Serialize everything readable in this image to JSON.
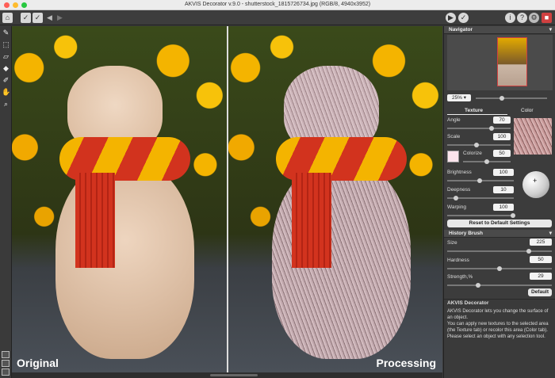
{
  "window": {
    "title": "AKVIS Decorator v.9.0 - shutterstock_1815726734.jpg (RGB/8, 4940x3952)"
  },
  "toolbar": {
    "left_icons": [
      "home-icon",
      "check-icon",
      "check-icon",
      "undo-icon",
      "redo-icon"
    ],
    "right_icons": [
      "play-icon",
      "apply-icon",
      "info-icon",
      "help-icon",
      "settings-icon",
      "gift-icon"
    ]
  },
  "tools": [
    "brush-icon",
    "selection-icon",
    "eraser-icon",
    "bucket-icon",
    "history-brush-icon",
    "hand-icon",
    "zoom-icon"
  ],
  "canvas": {
    "before_label": "Original",
    "after_label": "Processing"
  },
  "navigator": {
    "title": "Navigator",
    "zoom": "25%"
  },
  "tabs": {
    "texture": "Texture",
    "color": "Color"
  },
  "params": {
    "angle": {
      "label": "Angle",
      "value": "70"
    },
    "scale": {
      "label": "Scale",
      "value": "100"
    },
    "colorize": {
      "label": "Colorize",
      "value": "50"
    },
    "brightness": {
      "label": "Brightness",
      "value": "100"
    },
    "deepness": {
      "label": "Deepness",
      "value": "10"
    },
    "warping": {
      "label": "Warping",
      "value": "100"
    }
  },
  "reset_button": "Reset to Default Settings",
  "history_brush": {
    "title": "History Brush",
    "size": {
      "label": "Size",
      "value": "225"
    },
    "hardness": {
      "label": "Hardness",
      "value": "50"
    },
    "strength": {
      "label": "Strength,%",
      "value": "29"
    },
    "default_button": "Default"
  },
  "info_panel": {
    "title": "AKVIS Decorator",
    "line1": "AKVIS Decorator lets you change the surface of an object.",
    "line2": "You can apply new textures to the selected area (the Texture tab) or recolor this area (Color tab). Please select an object with any selection tool."
  },
  "colors": {
    "accent_red": "#d04040",
    "panel_bg": "#3c3c3c",
    "scarf_red": "#d2331e",
    "scarf_yellow": "#f4b400"
  }
}
